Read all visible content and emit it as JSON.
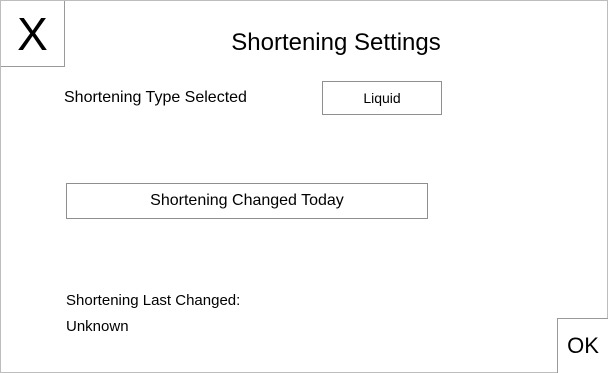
{
  "header": {
    "close_label": "X",
    "title": "Shortening Settings"
  },
  "shortening_type": {
    "label": "Shortening Type Selected",
    "value": "Liquid"
  },
  "actions": {
    "changed_today_label": "Shortening Changed Today",
    "ok_label": "OK"
  },
  "last_changed": {
    "label": "Shortening Last Changed:",
    "value": "Unknown"
  }
}
